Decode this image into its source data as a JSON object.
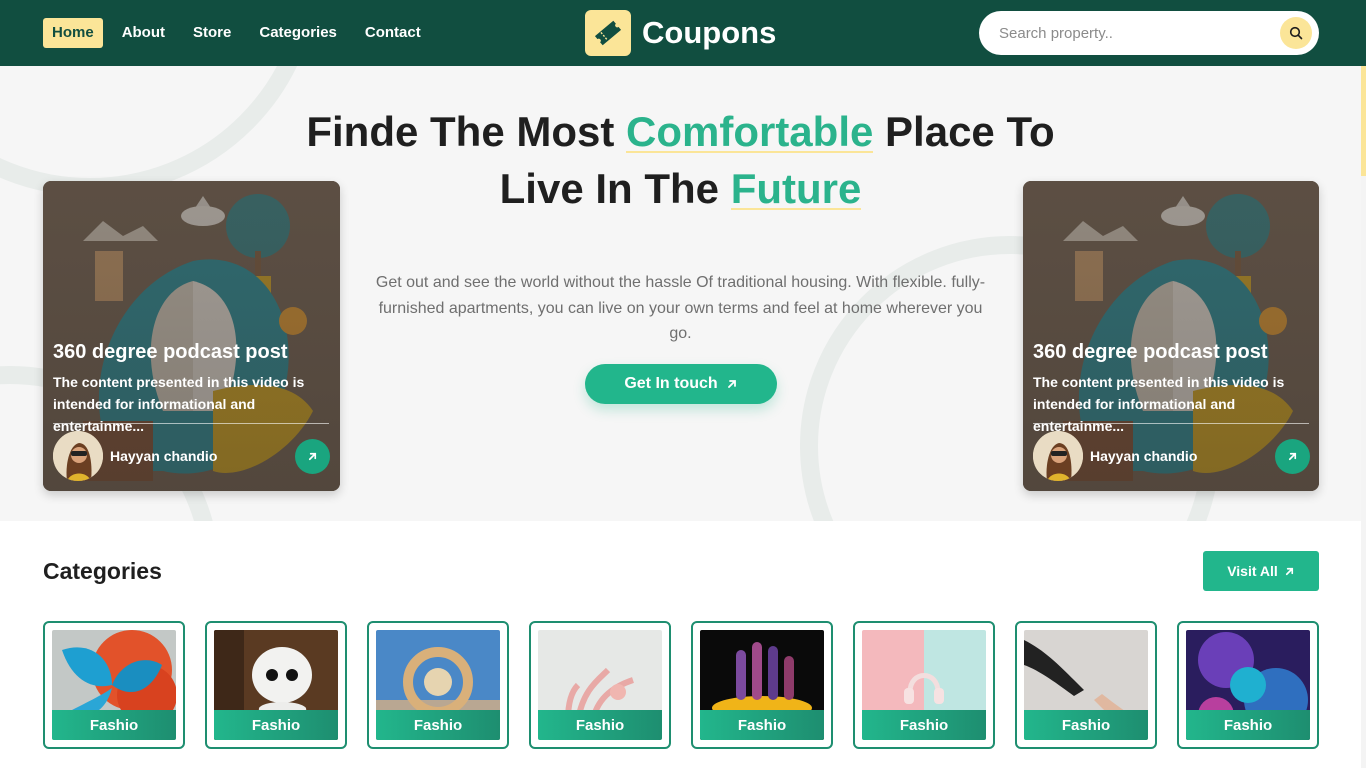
{
  "header": {
    "nav": [
      {
        "label": "Home",
        "active": true
      },
      {
        "label": "About",
        "active": false
      },
      {
        "label": "Store",
        "active": false
      },
      {
        "label": "Categories",
        "active": false
      },
      {
        "label": "Contact",
        "active": false
      }
    ],
    "logo_icon": "ticket-icon",
    "logo_text": "Coupons",
    "search_placeholder": "Search property..",
    "search_icon": "search-icon"
  },
  "hero": {
    "title_part1": "Finde The Most ",
    "title_highlight1": "Comfortable",
    "title_part2": " Place To",
    "title_part3": "Live In The ",
    "title_highlight2": "Future",
    "description": "Get out and see the world without the hassle Of traditional housing. With flexible. fully-furnished apartments, you can live on your own terms and feel at home wherever you go.",
    "cta_label": "Get In touch",
    "cta_icon": "arrow-up-right-icon"
  },
  "podcast_cards": [
    {
      "title": "360 degree podcast post",
      "text": "The content presented in this video is intended for informational and entertainme...",
      "author": "Hayyan chandio",
      "arrow_icon": "arrow-up-right-icon"
    },
    {
      "title": "360 degree podcast post",
      "text": "The content presented in this video is intended for informational and entertainme...",
      "author": "Hayyan chandio",
      "arrow_icon": "arrow-up-right-icon"
    }
  ],
  "categories": {
    "heading": "Categories",
    "visit_all_label": "Visit All",
    "items": [
      {
        "label": "Fashio"
      },
      {
        "label": "Fashio"
      },
      {
        "label": "Fashio"
      },
      {
        "label": "Fashio"
      },
      {
        "label": "Fashio"
      },
      {
        "label": "Fashio"
      },
      {
        "label": "Fashio"
      },
      {
        "label": "Fashio"
      }
    ]
  },
  "colors": {
    "brand_dark": "#114e40",
    "accent_green": "#22b68c",
    "accent_yellow": "#fbe598"
  }
}
